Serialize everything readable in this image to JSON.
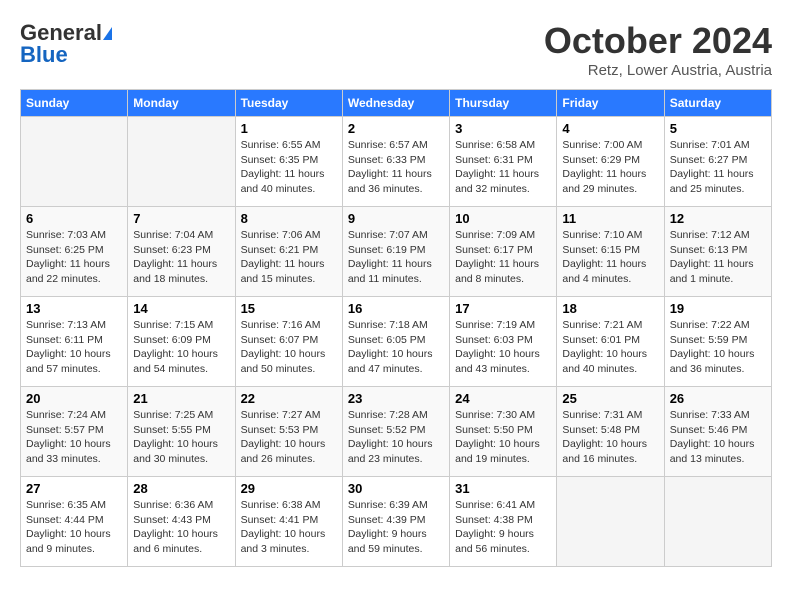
{
  "header": {
    "logo_general": "General",
    "logo_blue": "Blue",
    "month_title": "October 2024",
    "location": "Retz, Lower Austria, Austria"
  },
  "days_of_week": [
    "Sunday",
    "Monday",
    "Tuesday",
    "Wednesday",
    "Thursday",
    "Friday",
    "Saturday"
  ],
  "weeks": [
    [
      {
        "num": "",
        "empty": true
      },
      {
        "num": "",
        "empty": true
      },
      {
        "num": "1",
        "sunrise": "Sunrise: 6:55 AM",
        "sunset": "Sunset: 6:35 PM",
        "daylight": "Daylight: 11 hours and 40 minutes."
      },
      {
        "num": "2",
        "sunrise": "Sunrise: 6:57 AM",
        "sunset": "Sunset: 6:33 PM",
        "daylight": "Daylight: 11 hours and 36 minutes."
      },
      {
        "num": "3",
        "sunrise": "Sunrise: 6:58 AM",
        "sunset": "Sunset: 6:31 PM",
        "daylight": "Daylight: 11 hours and 32 minutes."
      },
      {
        "num": "4",
        "sunrise": "Sunrise: 7:00 AM",
        "sunset": "Sunset: 6:29 PM",
        "daylight": "Daylight: 11 hours and 29 minutes."
      },
      {
        "num": "5",
        "sunrise": "Sunrise: 7:01 AM",
        "sunset": "Sunset: 6:27 PM",
        "daylight": "Daylight: 11 hours and 25 minutes."
      }
    ],
    [
      {
        "num": "6",
        "sunrise": "Sunrise: 7:03 AM",
        "sunset": "Sunset: 6:25 PM",
        "daylight": "Daylight: 11 hours and 22 minutes."
      },
      {
        "num": "7",
        "sunrise": "Sunrise: 7:04 AM",
        "sunset": "Sunset: 6:23 PM",
        "daylight": "Daylight: 11 hours and 18 minutes."
      },
      {
        "num": "8",
        "sunrise": "Sunrise: 7:06 AM",
        "sunset": "Sunset: 6:21 PM",
        "daylight": "Daylight: 11 hours and 15 minutes."
      },
      {
        "num": "9",
        "sunrise": "Sunrise: 7:07 AM",
        "sunset": "Sunset: 6:19 PM",
        "daylight": "Daylight: 11 hours and 11 minutes."
      },
      {
        "num": "10",
        "sunrise": "Sunrise: 7:09 AM",
        "sunset": "Sunset: 6:17 PM",
        "daylight": "Daylight: 11 hours and 8 minutes."
      },
      {
        "num": "11",
        "sunrise": "Sunrise: 7:10 AM",
        "sunset": "Sunset: 6:15 PM",
        "daylight": "Daylight: 11 hours and 4 minutes."
      },
      {
        "num": "12",
        "sunrise": "Sunrise: 7:12 AM",
        "sunset": "Sunset: 6:13 PM",
        "daylight": "Daylight: 11 hours and 1 minute."
      }
    ],
    [
      {
        "num": "13",
        "sunrise": "Sunrise: 7:13 AM",
        "sunset": "Sunset: 6:11 PM",
        "daylight": "Daylight: 10 hours and 57 minutes."
      },
      {
        "num": "14",
        "sunrise": "Sunrise: 7:15 AM",
        "sunset": "Sunset: 6:09 PM",
        "daylight": "Daylight: 10 hours and 54 minutes."
      },
      {
        "num": "15",
        "sunrise": "Sunrise: 7:16 AM",
        "sunset": "Sunset: 6:07 PM",
        "daylight": "Daylight: 10 hours and 50 minutes."
      },
      {
        "num": "16",
        "sunrise": "Sunrise: 7:18 AM",
        "sunset": "Sunset: 6:05 PM",
        "daylight": "Daylight: 10 hours and 47 minutes."
      },
      {
        "num": "17",
        "sunrise": "Sunrise: 7:19 AM",
        "sunset": "Sunset: 6:03 PM",
        "daylight": "Daylight: 10 hours and 43 minutes."
      },
      {
        "num": "18",
        "sunrise": "Sunrise: 7:21 AM",
        "sunset": "Sunset: 6:01 PM",
        "daylight": "Daylight: 10 hours and 40 minutes."
      },
      {
        "num": "19",
        "sunrise": "Sunrise: 7:22 AM",
        "sunset": "Sunset: 5:59 PM",
        "daylight": "Daylight: 10 hours and 36 minutes."
      }
    ],
    [
      {
        "num": "20",
        "sunrise": "Sunrise: 7:24 AM",
        "sunset": "Sunset: 5:57 PM",
        "daylight": "Daylight: 10 hours and 33 minutes."
      },
      {
        "num": "21",
        "sunrise": "Sunrise: 7:25 AM",
        "sunset": "Sunset: 5:55 PM",
        "daylight": "Daylight: 10 hours and 30 minutes."
      },
      {
        "num": "22",
        "sunrise": "Sunrise: 7:27 AM",
        "sunset": "Sunset: 5:53 PM",
        "daylight": "Daylight: 10 hours and 26 minutes."
      },
      {
        "num": "23",
        "sunrise": "Sunrise: 7:28 AM",
        "sunset": "Sunset: 5:52 PM",
        "daylight": "Daylight: 10 hours and 23 minutes."
      },
      {
        "num": "24",
        "sunrise": "Sunrise: 7:30 AM",
        "sunset": "Sunset: 5:50 PM",
        "daylight": "Daylight: 10 hours and 19 minutes."
      },
      {
        "num": "25",
        "sunrise": "Sunrise: 7:31 AM",
        "sunset": "Sunset: 5:48 PM",
        "daylight": "Daylight: 10 hours and 16 minutes."
      },
      {
        "num": "26",
        "sunrise": "Sunrise: 7:33 AM",
        "sunset": "Sunset: 5:46 PM",
        "daylight": "Daylight: 10 hours and 13 minutes."
      }
    ],
    [
      {
        "num": "27",
        "sunrise": "Sunrise: 6:35 AM",
        "sunset": "Sunset: 4:44 PM",
        "daylight": "Daylight: 10 hours and 9 minutes."
      },
      {
        "num": "28",
        "sunrise": "Sunrise: 6:36 AM",
        "sunset": "Sunset: 4:43 PM",
        "daylight": "Daylight: 10 hours and 6 minutes."
      },
      {
        "num": "29",
        "sunrise": "Sunrise: 6:38 AM",
        "sunset": "Sunset: 4:41 PM",
        "daylight": "Daylight: 10 hours and 3 minutes."
      },
      {
        "num": "30",
        "sunrise": "Sunrise: 6:39 AM",
        "sunset": "Sunset: 4:39 PM",
        "daylight": "Daylight: 9 hours and 59 minutes."
      },
      {
        "num": "31",
        "sunrise": "Sunrise: 6:41 AM",
        "sunset": "Sunset: 4:38 PM",
        "daylight": "Daylight: 9 hours and 56 minutes."
      },
      {
        "num": "",
        "empty": true
      },
      {
        "num": "",
        "empty": true
      }
    ]
  ]
}
